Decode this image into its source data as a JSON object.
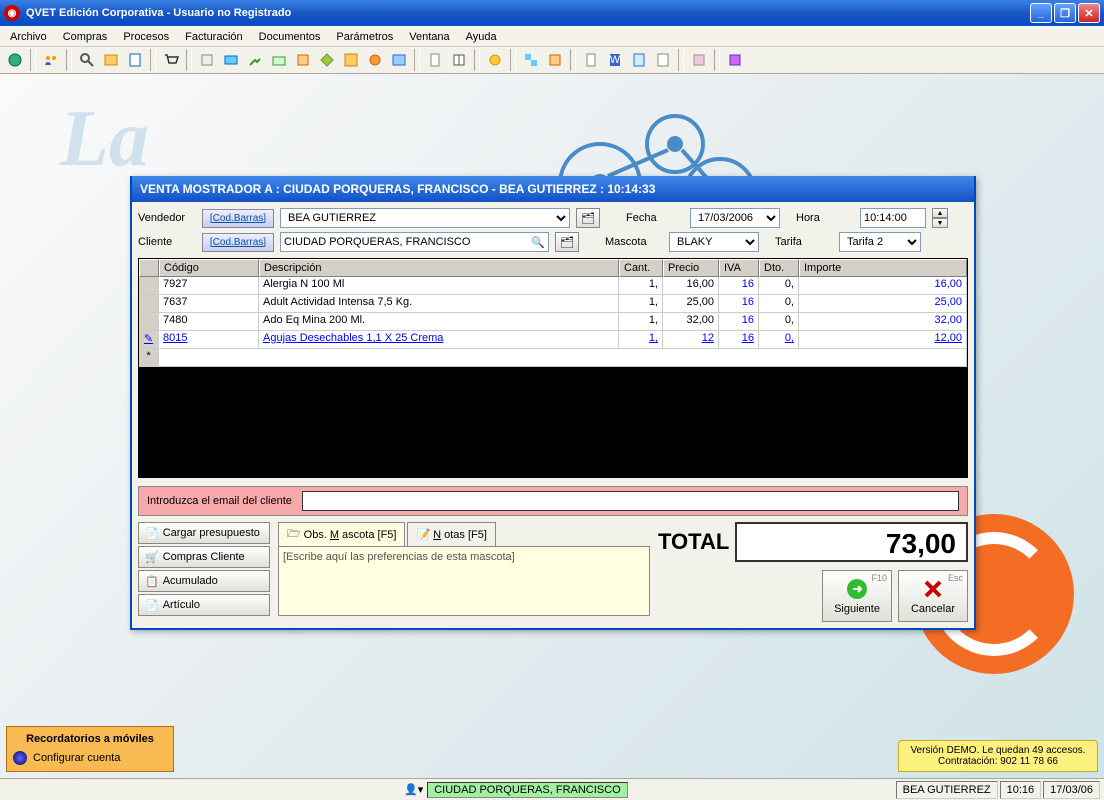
{
  "app": {
    "title": "QVET Edición Corporativa - Usuario no Registrado"
  },
  "menu": [
    "Archivo",
    "Compras",
    "Procesos",
    "Facturación",
    "Documentos",
    "Parámetros",
    "Ventana",
    "Ayuda"
  ],
  "dialog": {
    "title": "VENTA MOSTRADOR A : CIUDAD PORQUERAS, FRANCISCO - BEA GUTIERREZ : 10:14:33",
    "vendedor_lbl": "Vendedor",
    "cliente_lbl": "Cliente",
    "cod_barras": "[Cod.Barras]",
    "vendedor_val": "BEA GUTIERREZ",
    "cliente_val": "CIUDAD PORQUERAS, FRANCISCO",
    "fecha_lbl": "Fecha",
    "fecha_val": "17/03/2006",
    "hora_lbl": "Hora",
    "hora_val": "10:14:00",
    "mascota_lbl": "Mascota",
    "mascota_val": "BLAKY",
    "tarifa_lbl": "Tarifa",
    "tarifa_val": "Tarifa 2"
  },
  "grid": {
    "headers": [
      "",
      "Código",
      "Descripción",
      "Cant.",
      "Precio",
      "IVA",
      "Dto.",
      "Importe"
    ],
    "rows": [
      {
        "codigo": "7927",
        "desc": "Alergia N 100 Ml",
        "cant": "1,",
        "precio": "16,00",
        "iva": "16",
        "dto": "0,",
        "importe": "16,00",
        "edit": false
      },
      {
        "codigo": "7637",
        "desc": "Adult Actividad Intensa 7,5 Kg.",
        "cant": "1,",
        "precio": "25,00",
        "iva": "16",
        "dto": "0,",
        "importe": "25,00",
        "edit": false
      },
      {
        "codigo": "7480",
        "desc": "Ado Eq Mina 200 Ml.",
        "cant": "1,",
        "precio": "32,00",
        "iva": "16",
        "dto": "0,",
        "importe": "32,00",
        "edit": false
      },
      {
        "codigo": "8015",
        "desc": "Agujas Desechables 1,1 X 25 Crema",
        "cant": "1,",
        "precio": "12",
        "iva": "16",
        "dto": "0,",
        "importe": "12,00",
        "edit": true
      }
    ]
  },
  "email_prompt": "Introduzca el email del cliente",
  "buttons": {
    "cargar": "Cargar presupuesto",
    "compras": "Compras Cliente",
    "acum": "Acumulado",
    "articulo": "Artículo"
  },
  "tabs": {
    "obs": "Obs. Mascota [F5]",
    "notas": "Notas [F5]"
  },
  "memo_placeholder": "[Escribe aquí las preferencias de esta mascota]",
  "total": {
    "label": "TOTAL",
    "value": "73,00"
  },
  "bigbuttons": {
    "siguiente": "Siguiente",
    "siguiente_key": "F10",
    "cancelar": "Cancelar",
    "cancelar_key": "Esc"
  },
  "reminder": {
    "header": "Recordatorios a móviles",
    "config": "Configurar cuenta"
  },
  "demo": "Versión DEMO. Le quedan 49 accesos. Contratación: 902 11 78 66",
  "status": {
    "client": "CIUDAD PORQUERAS, FRANCISCO",
    "user": "BEA GUTIERREZ",
    "time": "10:16",
    "date": "17/03/06"
  }
}
